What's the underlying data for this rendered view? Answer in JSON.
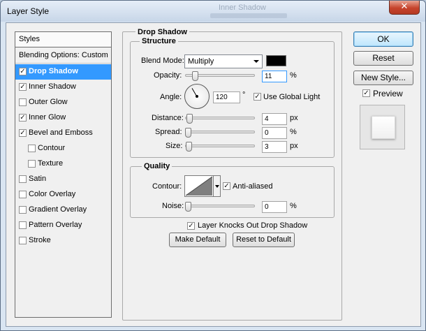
{
  "window": {
    "title": "Layer Style",
    "background_ghost_text": "Inner Shadow",
    "close_glyph": "✕"
  },
  "styles_panel": {
    "header": "Styles",
    "blending": "Blending Options: Custom",
    "items": [
      {
        "label": "Drop Shadow",
        "checked": true,
        "selected": true,
        "indent": false
      },
      {
        "label": "Inner Shadow",
        "checked": true,
        "selected": false,
        "indent": false
      },
      {
        "label": "Outer Glow",
        "checked": false,
        "selected": false,
        "indent": false
      },
      {
        "label": "Inner Glow",
        "checked": true,
        "selected": false,
        "indent": false
      },
      {
        "label": "Bevel and Emboss",
        "checked": true,
        "selected": false,
        "indent": false
      },
      {
        "label": "Contour",
        "checked": false,
        "selected": false,
        "indent": true
      },
      {
        "label": "Texture",
        "checked": false,
        "selected": false,
        "indent": true
      },
      {
        "label": "Satin",
        "checked": false,
        "selected": false,
        "indent": false
      },
      {
        "label": "Color Overlay",
        "checked": false,
        "selected": false,
        "indent": false
      },
      {
        "label": "Gradient Overlay",
        "checked": false,
        "selected": false,
        "indent": false
      },
      {
        "label": "Pattern Overlay",
        "checked": false,
        "selected": false,
        "indent": false
      },
      {
        "label": "Stroke",
        "checked": false,
        "selected": false,
        "indent": false
      }
    ]
  },
  "drop_shadow": {
    "title": "Drop Shadow",
    "structure": {
      "title": "Structure",
      "blend_mode_label": "Blend Mode:",
      "blend_mode_value": "Multiply",
      "shadow_color": "#000000",
      "opacity_label": "Opacity:",
      "opacity_value": "11",
      "opacity_unit": "%",
      "angle_label": "Angle:",
      "angle_value": "120",
      "angle_unit": "°",
      "use_global_light_label": "Use Global Light",
      "use_global_light": true,
      "distance_label": "Distance:",
      "distance_value": "4",
      "distance_unit": "px",
      "spread_label": "Spread:",
      "spread_value": "0",
      "spread_unit": "%",
      "size_label": "Size:",
      "size_value": "3",
      "size_unit": "px"
    },
    "quality": {
      "title": "Quality",
      "contour_label": "Contour:",
      "anti_aliased_label": "Anti-aliased",
      "anti_aliased": true,
      "noise_label": "Noise:",
      "noise_value": "0",
      "noise_unit": "%"
    },
    "knockout_label": "Layer Knocks Out Drop Shadow",
    "knockout": true,
    "make_default": "Make Default",
    "reset_to_default": "Reset to Default"
  },
  "actions": {
    "ok": "OK",
    "reset": "Reset",
    "new_style": "New Style...",
    "preview_label": "Preview",
    "preview": true
  },
  "colors": {
    "selection": "#3399ff",
    "title_bar": "#d9e5f2",
    "close_button": "#c6432c"
  },
  "icons": {
    "close": "close-icon",
    "dropdown": "chevron-down-icon",
    "check": "checkmark-icon"
  }
}
